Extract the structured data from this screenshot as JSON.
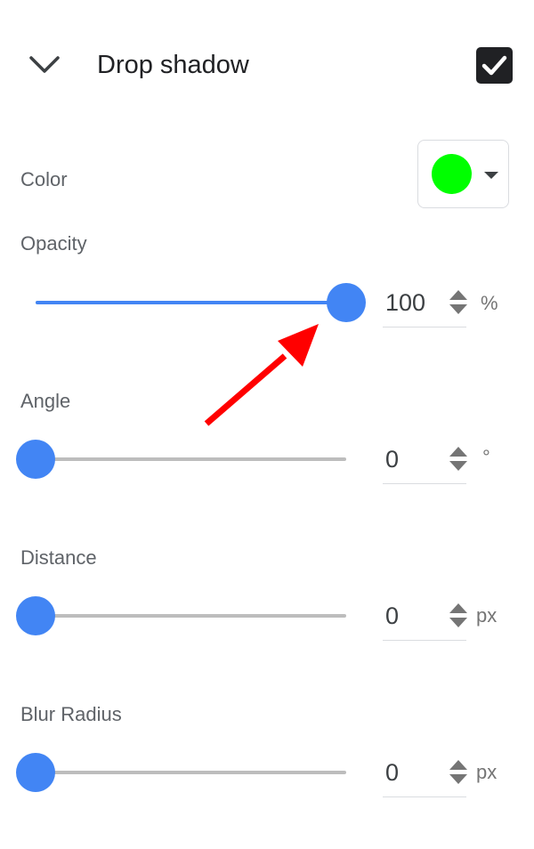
{
  "header": {
    "title": "Drop shadow",
    "expand_icon": "chevron-down-icon",
    "enabled": true,
    "checkbox_icon": "checkmark-icon"
  },
  "color": {
    "label": "Color",
    "value": "#00ff00",
    "dropdown_icon": "caret-down-icon"
  },
  "opacity": {
    "label": "Opacity",
    "value": "100",
    "unit": "%",
    "min": 0,
    "max": 100,
    "fraction": 1.0
  },
  "angle": {
    "label": "Angle",
    "value": "0",
    "unit": "°",
    "min": 0,
    "max": 360,
    "fraction": 0.0
  },
  "distance": {
    "label": "Distance",
    "value": "0",
    "unit": "px",
    "fraction": 0.0
  },
  "blur": {
    "label": "Blur Radius",
    "value": "0",
    "unit": "px",
    "fraction": 0.0
  },
  "colors": {
    "accent": "#4285f4",
    "annotation_arrow": "#ff0000",
    "track_inactive": "#bdbdbd"
  },
  "annotation": {
    "type": "arrow",
    "points_to": "opacity-slider-thumb"
  }
}
